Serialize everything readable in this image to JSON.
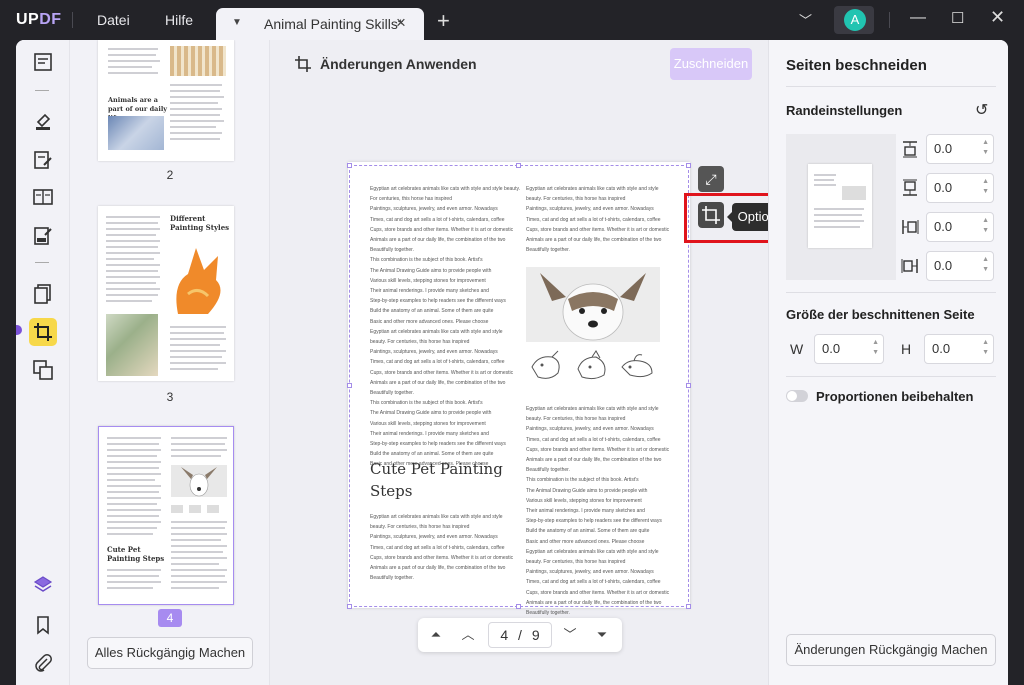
{
  "app": {
    "logo": "UPDF",
    "menu": [
      "Datei",
      "Hilfe"
    ],
    "tab_title": "Animal Painting Skills*",
    "avatar_letter": "A"
  },
  "toolbar": {
    "apply_changes": "Änderungen Anwenden",
    "crop_button": "Zuschneiden",
    "options_tooltip": "Optionen"
  },
  "thumbnails": {
    "pages": [
      {
        "number": "2",
        "heading": "Animals are a part of our daily life"
      },
      {
        "number": "3",
        "heading": "Different Painting Styles"
      },
      {
        "number": "4",
        "heading": "Cute Pet Painting Steps",
        "selected": true
      }
    ],
    "undo_all_button": "Alles Rückgängig Machen"
  },
  "page": {
    "heading": "Cute Pet Painting Steps",
    "left_text": "Egyptian art celebrates animals like cats with style and style beauty. For centuries, this horse has inspired\nPaintings, sculptures, jewelry, and even armor. Nowadays\nTimes, cat and dog art sells a lot of t-shirts, calendars, coffee\nCups, store brands and other items. Whether it is art or domestic\nAnimals are a part of our daily life, the combination of the two\nBeautifully together.\nThis combination is the subject of this book. Artist's\nThe Animal Drawing Guide aims to provide people with\nVarious skill levels, stepping stones for improvement\nTheir animal renderings. I provide many sketches and\nStep-by-step examples to help readers see the different ways\nBuild the anatomy of an animal. Some of them are quite\nBasic and other more advanced ones. Please choose\nEgyptian art celebrates animals like cats with style and style\nbeauty. For centuries, this horse has inspired\nPaintings, sculptures, jewelry, and even armor. Nowadays\nTimes, cat and dog art sells a lot of t-shirts, calendars, coffee\nCups, store brands and other items. Whether it is art or domestic\nAnimals are a part of our daily life, the combination of the two\nBeautifully together.\nThis combination is the subject of this book. Artist's\nThe Animal Drawing Guide aims to provide people with\nVarious skill levels, stepping stones for improvement\nTheir animal renderings. I provide many sketches and\nStep-by-step examples to help readers see the different ways\nBuild the anatomy of an animal. Some of them are quite\nBasic and other more advanced ones. Please choose",
    "left_bottom_text": "Egyptian art celebrates animals like cats with style and style\nbeauty. For centuries, this horse has inspired\nPaintings, sculptures, jewelry, and even armor. Nowadays\nTimes, cat and dog art sells a lot of t-shirts, calendars, coffee\nCups, store brands and other items. Whether it is art or domestic\nAnimals are a part of our daily life, the combination of the two\nBeautifully together.",
    "right_top_text": "Egyptian art celebrates animals like cats with style and style\nbeauty. For centuries, this horse has inspired\nPaintings, sculptures, jewelry, and even armor. Nowadays\nTimes, cat and dog art sells a lot of t-shirts, calendars, coffee\nCups, store brands and other items. Whether it is art or domestic\nAnimals are a part of our daily life, the combination of the two\nBeautifully together.",
    "right_bottom_text": "Egyptian art celebrates animals like cats with style and style\nbeauty. For centuries, this horse has inspired\nPaintings, sculptures, jewelry, and even armor. Nowadays\nTimes, cat and dog art sells a lot of t-shirts, calendars, coffee\nCups, store brands and other items. Whether it is art or domestic\nAnimals are a part of our daily life, the combination of the two\nBeautifully together.\nThis combination is the subject of this book. Artist's\nThe Animal Drawing Guide aims to provide people with\nVarious skill levels, stepping stones for improvement\nTheir animal renderings. I provide many sketches and\nStep-by-step examples to help readers see the different ways\nBuild the anatomy of an animal. Some of them are quite\nBasic and other more advanced ones. Please choose\nEgyptian art celebrates animals like cats with style and style\nbeauty. For centuries, this horse has inspired\nPaintings, sculptures, jewelry, and even armor. Nowadays\nTimes, cat and dog art sells a lot of t-shirts, calendars, coffee\nCups, store brands and other items. Whether it is art or domestic\nAnimals are a part of our daily life, the combination of the two\nBeautifully together."
  },
  "pager": {
    "current": "4",
    "separator": "/",
    "total": "9"
  },
  "right_panel": {
    "title": "Seiten beschneiden",
    "margin_settings": "Randeinstellungen",
    "margins": {
      "top": "0.0",
      "bottom": "0.0",
      "left": "0.0",
      "right": "0.0"
    },
    "cropped_size": "Größe der beschnittenen Seite",
    "width_label": "W",
    "width_value": "0.0",
    "height_label": "H",
    "height_value": "0.0",
    "keep_proportions": "Proportionen beibehalten",
    "undo_changes_button": "Änderungen Rückgängig Machen"
  },
  "colors": {
    "accent": "#a78bf0",
    "highlight": "#e0141c",
    "active_tool": "#f7d84a"
  }
}
